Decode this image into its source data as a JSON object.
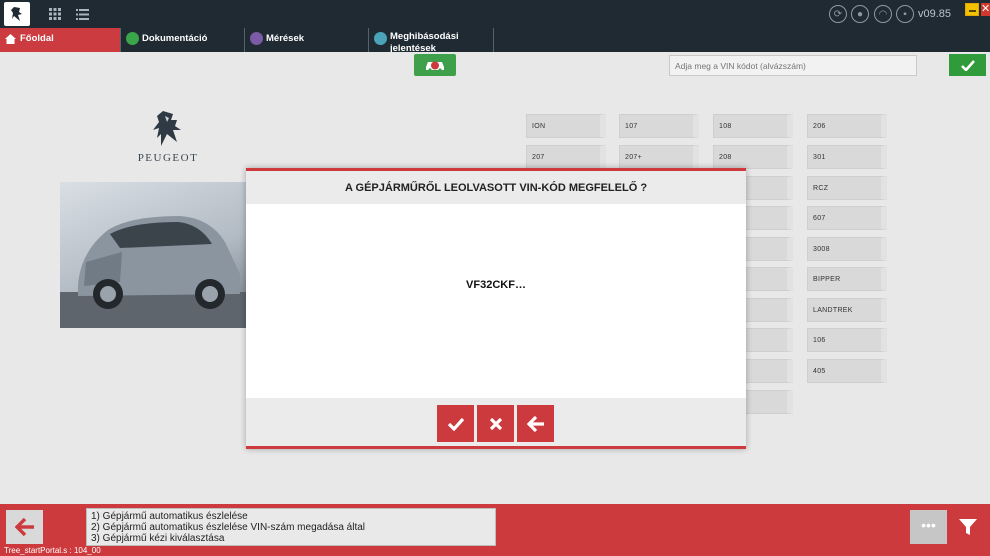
{
  "header": {
    "version": "v09.85",
    "close_glyph": "✕"
  },
  "tabs": [
    {
      "label": "Főoldal",
      "active": true,
      "icon": "home-icon"
    },
    {
      "label": "Dokumentáció",
      "active": false,
      "icon": "document-icon"
    },
    {
      "label": "Mérések",
      "active": false,
      "icon": "waveform-icon"
    },
    {
      "label": "Meghibásodási\njelentések",
      "active": false,
      "icon": "fault-report-icon"
    }
  ],
  "toolbar": {
    "vin_placeholder": "Adja meg a VIN kódot (alvázszám)"
  },
  "brand": {
    "name": "PEUGEOT"
  },
  "models": {
    "col1": [
      "ION",
      "207"
    ],
    "col2": [
      "107",
      "207+"
    ],
    "col3": [
      "108",
      "208"
    ],
    "col4": [
      "206",
      "301",
      "RCZ",
      "607",
      "3008",
      "BIPPER",
      "LANDTREK",
      "106",
      "405"
    ]
  },
  "dialog": {
    "title": "A GÉPJÁRMŰRŐL LEOLVASOTT VIN-KÓD MEGFELELŐ ?",
    "vin": "VF32CKF…"
  },
  "bottom": {
    "steps": [
      "1) Gépjármű automatikus észlelése",
      "2) Gépjármű automatikus észlelése VIN-szám megadása által",
      "3) Gépjármű kézi kiválasztása"
    ],
    "more_label": "•••",
    "status": "Tree_startPortal.s : 104_00"
  },
  "colors": {
    "accent_red": "#cc3a3e",
    "topbar": "#1f2a33",
    "ok_green": "#2f9b3a"
  }
}
